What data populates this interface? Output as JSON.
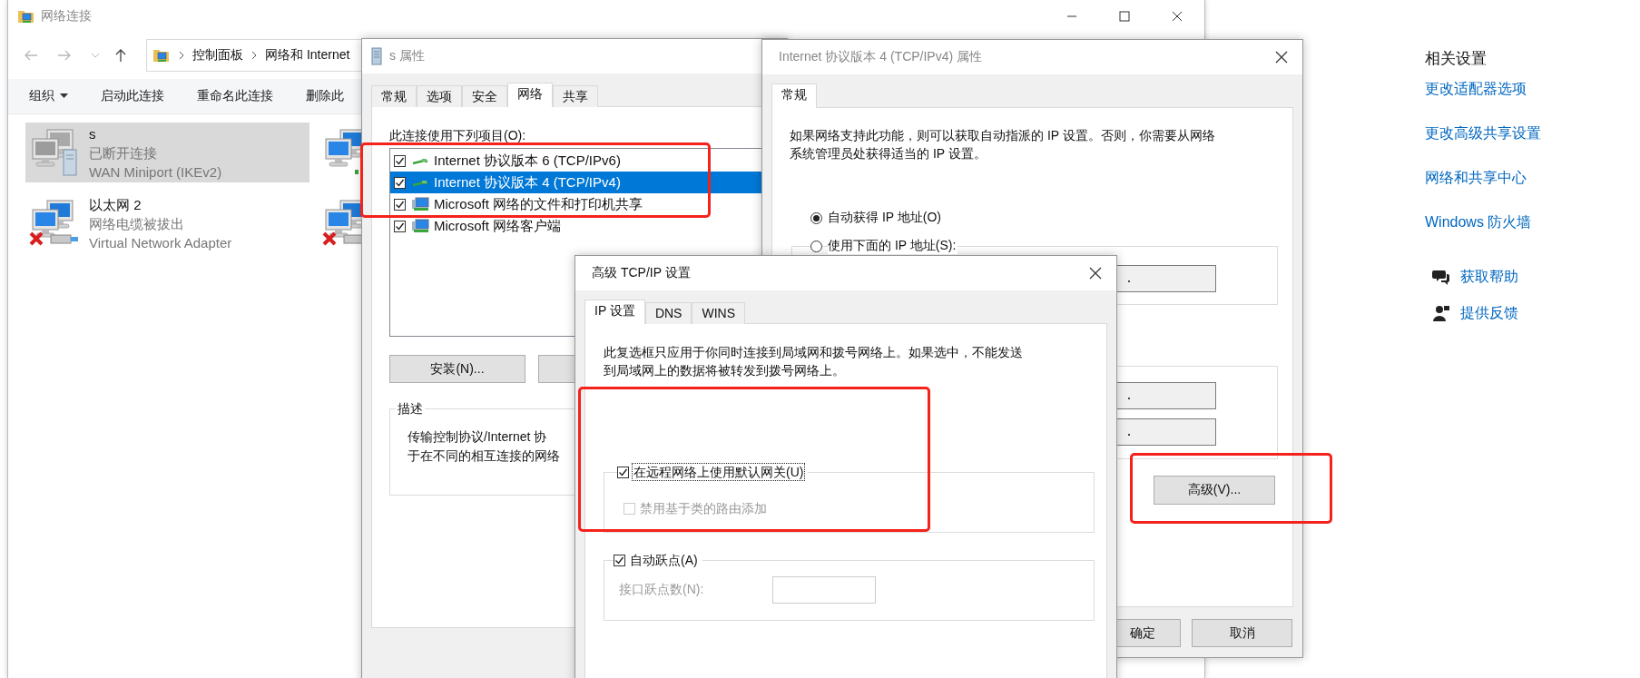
{
  "explorer": {
    "title": "网络连接",
    "breadcrumb": [
      "控制面板",
      "网络和 Internet"
    ],
    "toolbar": [
      {
        "label": "组织",
        "kind": "menu"
      },
      {
        "label": "启动此连接",
        "kind": "command"
      },
      {
        "label": "重命名此连接",
        "kind": "command"
      },
      {
        "label": "删除此",
        "kind": "command"
      }
    ],
    "connections": [
      {
        "name": "s",
        "status": "已断开连接",
        "device": "WAN Miniport (IKEv2)",
        "kind": "vpn",
        "selected": true
      },
      {
        "name": "以太网 2",
        "status": "网络电缆被拔出",
        "device": "Virtual Network Adapter",
        "kind": "unplugged",
        "selected": false
      }
    ],
    "covered_connections": [
      {
        "kind": "wireless"
      },
      {
        "kind": "unplugged"
      }
    ]
  },
  "related_settings": {
    "title": "相关设置",
    "links": [
      "更改适配器选项",
      "更改高级共享设置",
      "网络和共享中心",
      "Windows 防火墙"
    ],
    "help": [
      {
        "label": "获取帮助",
        "kind": "help"
      },
      {
        "label": "提供反馈",
        "kind": "feedback"
      }
    ]
  },
  "connection_properties": {
    "title": "s 属性",
    "tabs": [
      {
        "label": "常规",
        "selected": false
      },
      {
        "label": "选项",
        "selected": false
      },
      {
        "label": "安全",
        "selected": false
      },
      {
        "label": "网络",
        "selected": true
      },
      {
        "label": "共享",
        "selected": false
      }
    ],
    "items_label": "此连接使用下列项目(O):",
    "items": [
      {
        "label": "Internet 协议版本 6 (TCP/IPv6)",
        "checked": true,
        "selected": false,
        "kind": "protocol"
      },
      {
        "label": "Internet 协议版本 4 (TCP/IPv4)",
        "checked": true,
        "selected": true,
        "kind": "protocol"
      },
      {
        "label": "Microsoft 网络的文件和打印机共享",
        "checked": true,
        "selected": false,
        "kind": "service"
      },
      {
        "label": "Microsoft 网络客户端",
        "checked": true,
        "selected": false,
        "kind": "service"
      }
    ],
    "install_button": "安装(N)...",
    "description": {
      "title": "描述",
      "lines": [
        "传输控制协议/Internet 协",
        "于在不同的相互连接的网络"
      ]
    }
  },
  "ipv4_properties": {
    "title": "Internet 协议版本 4 (TCP/IPv4) 属性",
    "tabs": [
      {
        "label": "常规",
        "selected": true
      }
    ],
    "intro": "如果网络支持此功能，则可以获取自动指派的 IP 设置。否则，你需要从网络系统管理员处获得适当的 IP 设置。",
    "ip_mode": [
      {
        "label": "自动获得 IP 地址(O)",
        "selected": true
      },
      {
        "label": "使用下面的 IP 地址(S):",
        "selected": false
      }
    ],
    "advanced_button": "高级(V)...",
    "ok_button": "确定",
    "cancel_button": "取消"
  },
  "advanced_tcpip": {
    "title": "高级 TCP/IP 设置",
    "tabs": [
      {
        "label": "IP 设置",
        "selected": true
      },
      {
        "label": "DNS",
        "selected": false
      },
      {
        "label": "WINS",
        "selected": false
      }
    ],
    "note": "此复选框只应用于你同时连接到局域网和拨号网络上。如果选中，不能发送到局域网上的数据将被转发到拨号网络上。",
    "gateway": {
      "label": "在远程网络上使用默认网关(U)",
      "checked": true,
      "focused": true,
      "disabled": false
    },
    "class_routes": {
      "label": "禁用基于类的路由添加",
      "checked": false,
      "focused": false,
      "disabled": true
    },
    "auto_metric": {
      "label": "自动跃点(A)",
      "checked": true,
      "focused": false,
      "disabled": false
    },
    "metric": {
      "label": "接口跃点数(N):",
      "disabled": true
    }
  }
}
